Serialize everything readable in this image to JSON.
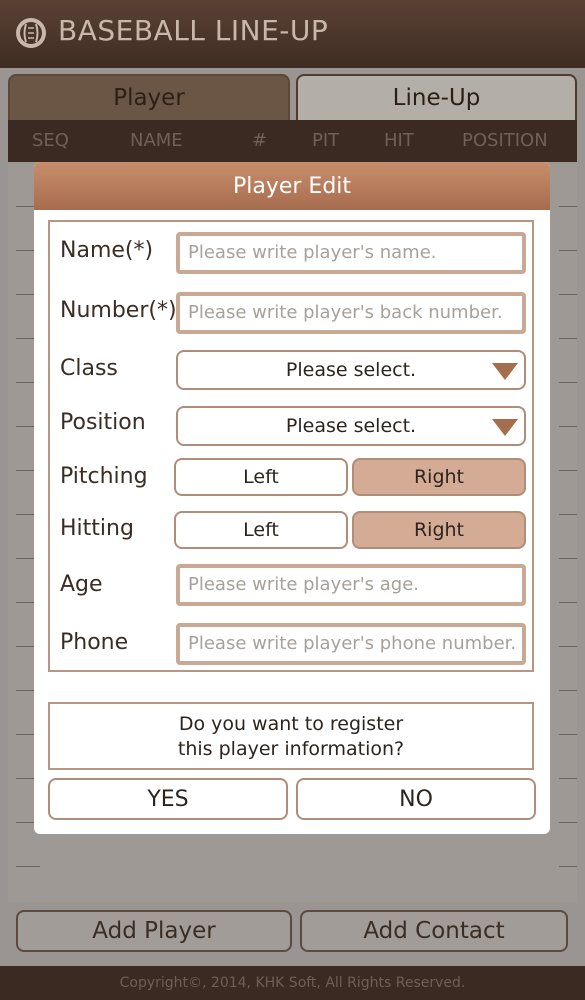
{
  "app": {
    "title": "BASEBALL LINE-UP"
  },
  "tabs": [
    {
      "label": "Player"
    },
    {
      "label": "Line-Up"
    }
  ],
  "columns": [
    "SEQ",
    "NAME",
    "#",
    "PIT",
    "HIT",
    "POSITION"
  ],
  "bottom": {
    "add_player": "Add Player",
    "add_contact": "Add Contact"
  },
  "footer": {
    "copyright": "Copyright©, 2014, KHK Soft, All Rights Reserved."
  },
  "dialog": {
    "title": "Player Edit",
    "fields": {
      "name": {
        "label": "Name(*)",
        "placeholder": "Please write player's name."
      },
      "number": {
        "label": "Number(*)",
        "placeholder": "Please write player's back number."
      },
      "class": {
        "label": "Class",
        "value": "Please select."
      },
      "position": {
        "label": "Position",
        "value": "Please select."
      },
      "pitching": {
        "label": "Pitching",
        "left": "Left",
        "right": "Right",
        "selected": "Right"
      },
      "hitting": {
        "label": "Hitting",
        "left": "Left",
        "right": "Right",
        "selected": "Right"
      },
      "age": {
        "label": "Age",
        "placeholder": "Please write player's age."
      },
      "phone": {
        "label": "Phone",
        "placeholder": "Please write player's phone number."
      }
    },
    "confirm": {
      "line1": "Do you want to register",
      "line2": "this player information?"
    },
    "yes": "YES",
    "no": "NO"
  }
}
